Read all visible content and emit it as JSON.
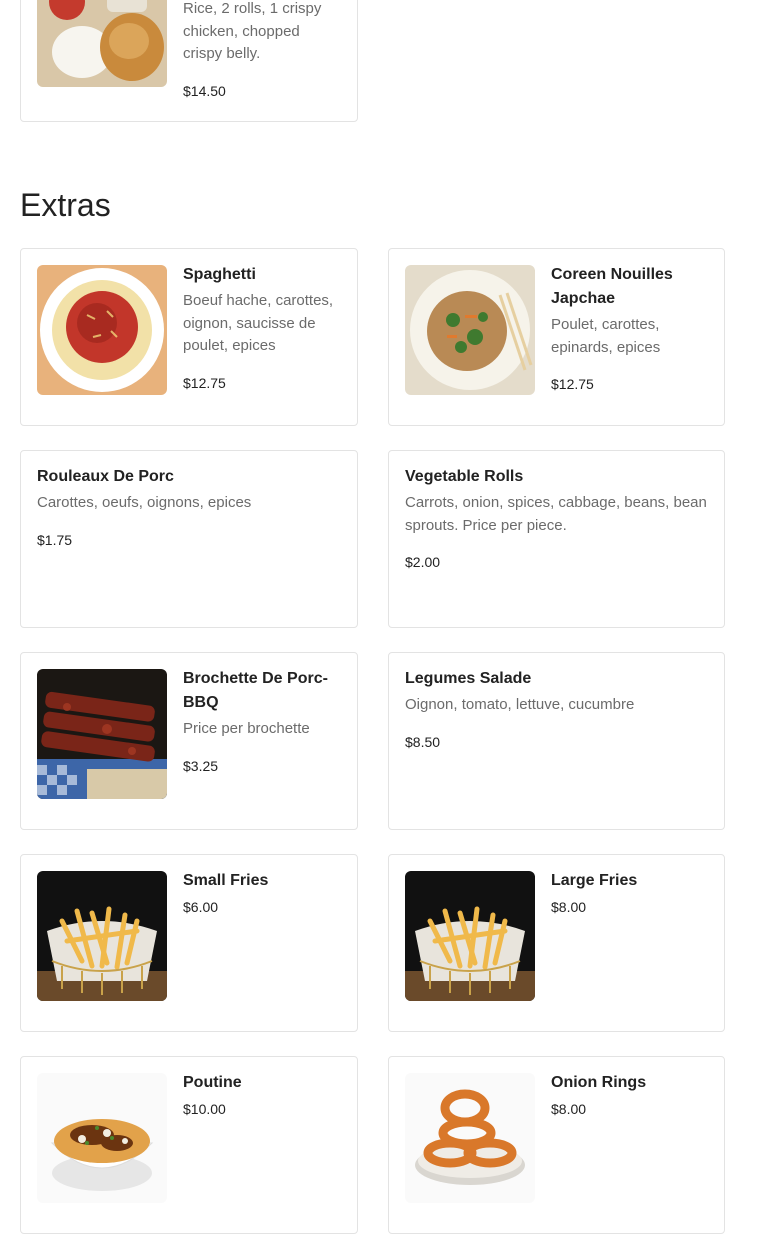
{
  "prev_section": {
    "item": {
      "desc_tail": "Rice, 2 rolls, 1 crispy chicken, chopped crispy belly.",
      "price": "$14.50"
    }
  },
  "extras": {
    "title": "Extras",
    "items": [
      {
        "name": "Spaghetti",
        "desc": "Boeuf hache, carottes, oignon, saucisse de poulet, epices",
        "price": "$12.75",
        "image": "spaghetti-photo"
      },
      {
        "name": "Coreen Nouilles Japchae",
        "desc": "Poulet, carottes, epinards, epices",
        "price": "$12.75",
        "image": "japchae-photo"
      },
      {
        "name": "Rouleaux De Porc",
        "desc": "Carottes, oeufs, oignons, epices",
        "price": "$1.75"
      },
      {
        "name": "Vegetable Rolls",
        "desc": "Carrots, onion, spices, cabbage, beans, bean sprouts. Price per piece.",
        "price": "$2.00"
      },
      {
        "name": "Brochette De Porc-BBQ",
        "desc": "Price per brochette",
        "price": "$3.25",
        "image": "bbq-skewer-photo"
      },
      {
        "name": "Legumes Salade",
        "desc": "Oignon, tomato, lettuve, cucumbre",
        "price": "$8.50"
      },
      {
        "name": "Small Fries",
        "price": "$6.00",
        "image": "fries-basket-photo"
      },
      {
        "name": "Large Fries",
        "price": "$8.00",
        "image": "fries-basket-photo"
      },
      {
        "name": "Poutine",
        "price": "$10.00",
        "image": "poutine-photo"
      },
      {
        "name": "Onion Rings",
        "price": "$8.00",
        "image": "onion-rings-photo"
      }
    ]
  }
}
